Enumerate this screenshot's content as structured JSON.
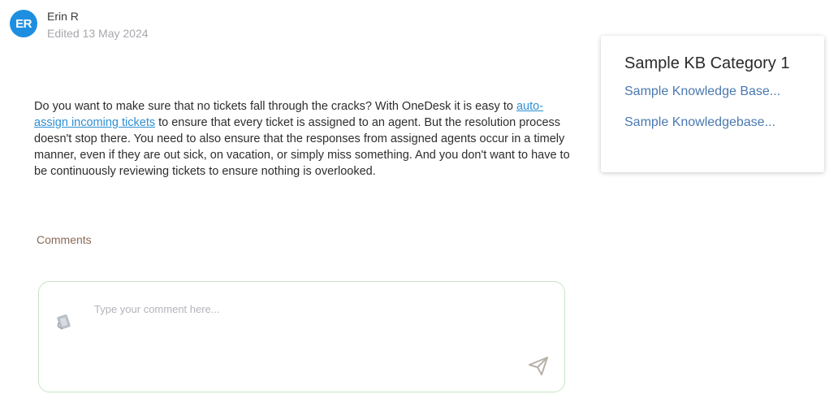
{
  "author": {
    "initials": "ER",
    "name": "Erin R",
    "edited": "Edited 13 May 2024",
    "avatar_color": "#1e8fe0"
  },
  "article": {
    "text_1": "Do you want to make sure that no tickets fall through the cracks? With OneDesk it is easy to ",
    "link_text": "auto-assign incoming tickets",
    "text_2": " to ensure that every ticket is assigned to an agent. But the resolution process doesn't stop there. You need to also ensure that the responses from assigned agents occur in a timely manner, even if they are out sick, on vacation, or simply miss something. And you don't want to have to be continuously reviewing tickets to ensure nothing is overlooked.",
    "link_color": "#2f8fd2"
  },
  "comments": {
    "heading": "Comments",
    "placeholder": "Type your comment here...",
    "attach_icon": "attachment-icon",
    "send_icon": "send-icon",
    "border_color": "#c9e3c6"
  },
  "sidebar": {
    "category_title": "Sample KB Category 1",
    "links": [
      {
        "label": "Sample Knowledge Base..."
      },
      {
        "label": "Sample Knowledgebase..."
      }
    ],
    "link_color": "#4a78b0"
  }
}
